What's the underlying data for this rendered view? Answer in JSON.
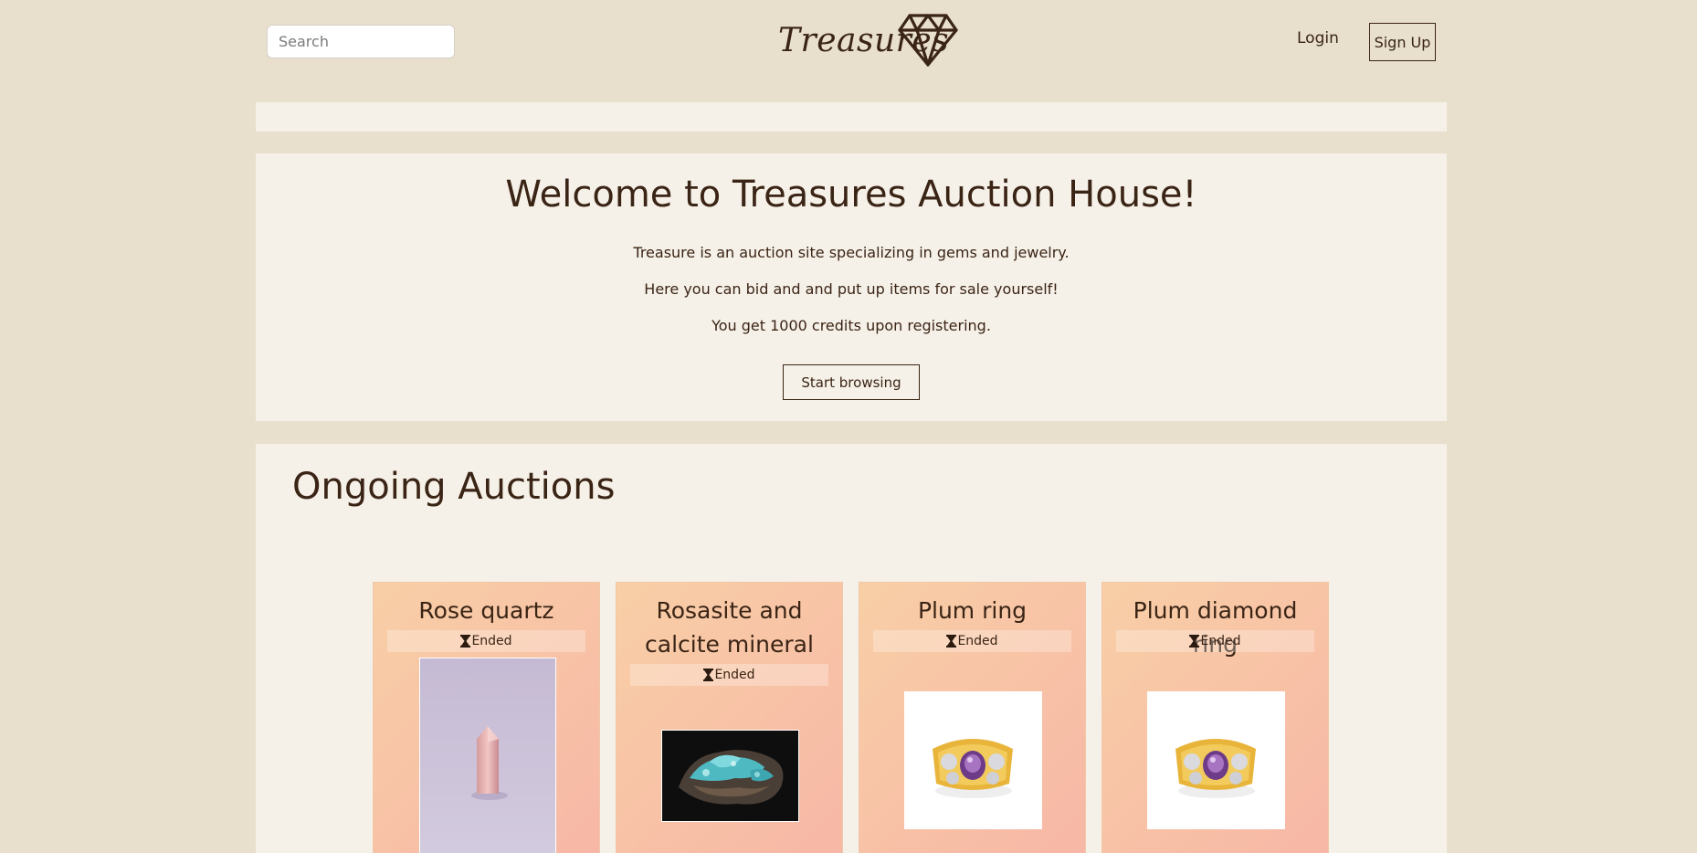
{
  "header": {
    "search_placeholder": "Search",
    "logo_text": "Treasures",
    "logo_icon": "diamond-icon",
    "login_label": "Login",
    "signup_label": "Sign Up"
  },
  "hero": {
    "title": "Welcome to Treasures Auction House!",
    "line1": "Treasure is an auction site specializing in gems and jewelry.",
    "line2": "Here you can bid and and put up items for sale yourself!",
    "line3": "You get 1000 credits upon registering.",
    "button_label": "Start browsing"
  },
  "auctions": {
    "title": "Ongoing Auctions",
    "items": [
      {
        "title": "Rose quartz",
        "status": "Ended",
        "image": "rose-quartz-crystal"
      },
      {
        "title": "Rosasite and calcite mineral",
        "status": "Ended",
        "image": "rosasite-calcite-mineral"
      },
      {
        "title": "Plum ring",
        "status": "Ended",
        "image": "plum-gemstone-ring"
      },
      {
        "title": "Plum diamond ring",
        "status": "Ended",
        "image": "plum-diamond-ring"
      }
    ]
  },
  "colors": {
    "page_bg": "#e8dfcd",
    "panel_bg": "#f6f1e8",
    "text": "#3a2415",
    "card_gradient_start": "#f8cfa6",
    "card_gradient_end": "#f7b6a6"
  }
}
